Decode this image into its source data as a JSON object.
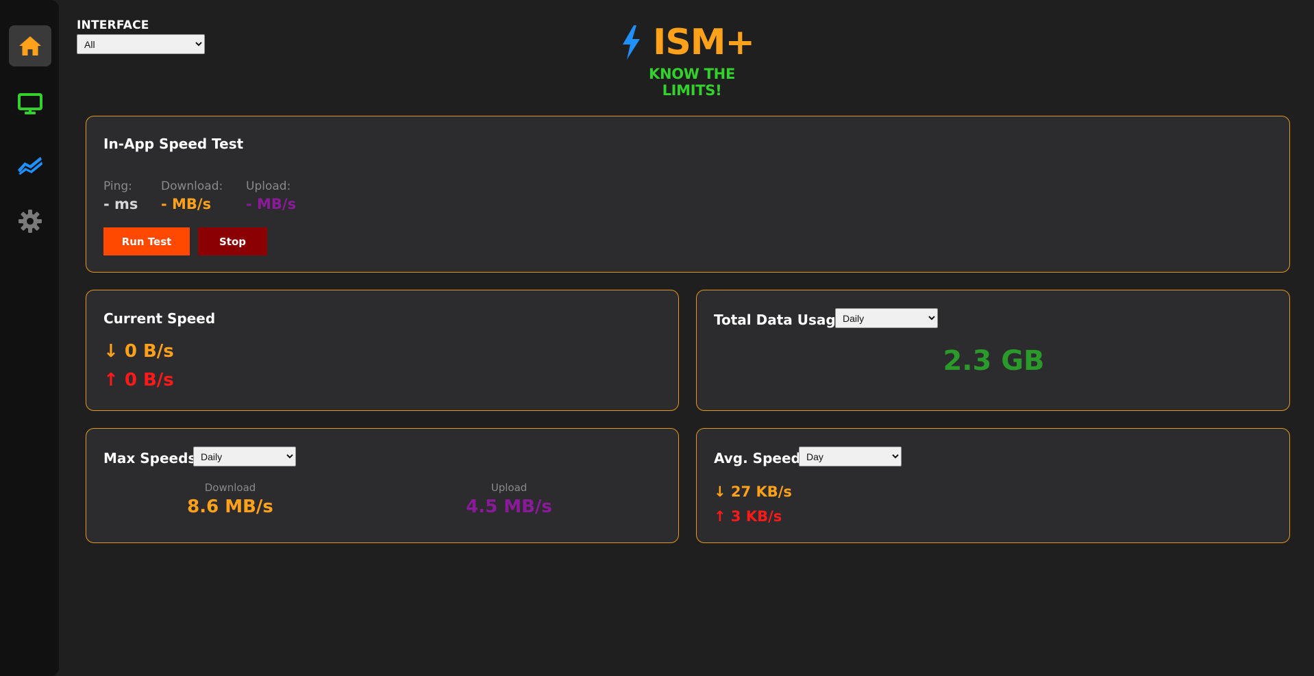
{
  "colors": {
    "accent": "#ffa11a",
    "tagline": "#33d12b",
    "upload": "#8b1a9a",
    "error": "#ff1a1a",
    "card_border": "#e59a1a",
    "run_button": "#ff4800",
    "stop_button": "#8b0000",
    "total": "#2a9a2a"
  },
  "sidebar": {
    "items": [
      {
        "icon": "home-icon",
        "active": true
      },
      {
        "icon": "monitor-icon",
        "active": false
      },
      {
        "icon": "chart-icon",
        "active": false
      },
      {
        "icon": "gear-icon",
        "active": false
      }
    ]
  },
  "interface": {
    "label": "INTERFACE",
    "selected": "All"
  },
  "brand": {
    "title": "ISM+",
    "tagline": "KNOW THE LIMITS!"
  },
  "speed_test": {
    "title": "In-App Speed Test",
    "ping_label": "Ping:",
    "ping_value": "- ms",
    "download_label": "Download:",
    "download_value": "- MB/s",
    "upload_label": "Upload:",
    "upload_value": "- MB/s",
    "run_label": "Run Test",
    "stop_label": "Stop"
  },
  "current_speed": {
    "title": "Current Speed",
    "down": "↓ 0 B/s",
    "up": "↑ 0 B/s"
  },
  "total_usage": {
    "title": "Total Data Usage:",
    "period": "Daily",
    "value": "2.3 GB"
  },
  "max_speeds": {
    "title": "Max Speeds:",
    "period": "Daily",
    "download_label": "Download",
    "download_value": "8.6 MB/s",
    "upload_label": "Upload",
    "upload_value": "4.5 MB/s"
  },
  "avg_speed": {
    "title": "Avg. Speed:",
    "period": "Day",
    "down": "↓ 27 KB/s",
    "up": "↑ 3 KB/s"
  }
}
